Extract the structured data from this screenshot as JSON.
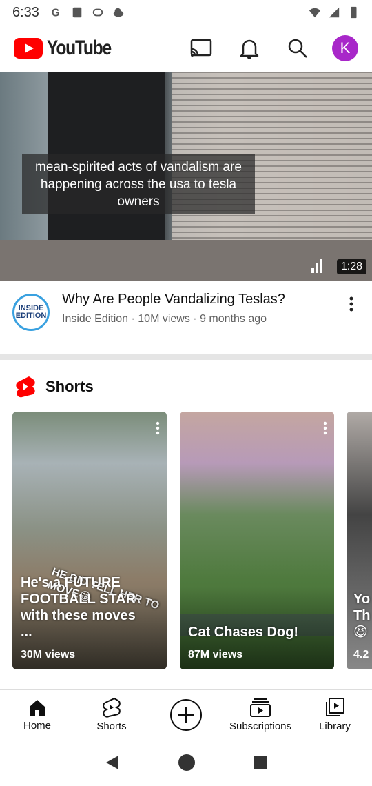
{
  "status_bar": {
    "time": "6:33"
  },
  "header": {
    "logo_text": "YouTube",
    "avatar_letter": "K",
    "avatar_color": "#a827c9",
    "brand_color": "#ff0000"
  },
  "video": {
    "caption": "mean-spirited acts of vandalism are happening across the usa to tesla owners",
    "duration": "1:28",
    "title": "Why Are People Vandalizing Teslas?",
    "channel_avatar_text": "INSIDE EDITION",
    "subtitle": "Inside Edition · 10M views · 9 months ago"
  },
  "shorts": {
    "section_title": "Shorts",
    "items": [
      {
        "overlay": "HE DID TELL HER TO MOVE😂",
        "title": "He's a FUTURE FOOTBALL STAR with these moves ...",
        "views": "30M views"
      },
      {
        "title": "Cat Chases Dog!",
        "views": "87M views"
      },
      {
        "title": "Yo Th 😆",
        "views": "4.2"
      }
    ]
  },
  "bottom_nav": {
    "items": [
      {
        "label": "Home",
        "icon": "home-icon"
      },
      {
        "label": "Shorts",
        "icon": "shorts-icon"
      },
      {
        "label": "",
        "icon": "create-icon"
      },
      {
        "label": "Subscriptions",
        "icon": "subscriptions-icon"
      },
      {
        "label": "Library",
        "icon": "library-icon"
      }
    ]
  }
}
